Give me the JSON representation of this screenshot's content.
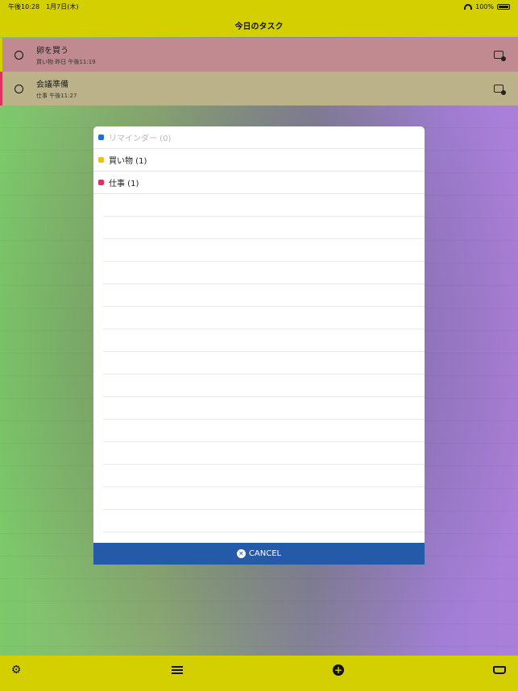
{
  "status": {
    "time": "午後10:28",
    "date": "1月7日(木)",
    "battery": "100%"
  },
  "nav": {
    "title": "今日のタスク"
  },
  "tasks": [
    {
      "title": "卵を買う",
      "sub": "買い物 昨日 午後11:19"
    },
    {
      "title": "会議準備",
      "sub": "仕事 午後11:27"
    }
  ],
  "lists": [
    {
      "label": "リマインダー (0)",
      "color": "#1f6fd6"
    },
    {
      "label": "買い物 (1)",
      "color": "#e3c417"
    },
    {
      "label": "仕事 (1)",
      "color": "#e03060"
    }
  ],
  "modal": {
    "cancel_label": "CANCEL"
  },
  "icons": {
    "wifi": "wifi-icon",
    "battery": "battery-icon",
    "check": "circle-icon",
    "calendar": "calendar-icon",
    "gear": "gear-icon",
    "list": "list-icon",
    "add": "add-circle-icon",
    "inbox": "inbox-icon",
    "cancel": "close-circle-icon"
  },
  "colors": {
    "bar": "#d3cf00",
    "cancel": "#255aa8"
  }
}
